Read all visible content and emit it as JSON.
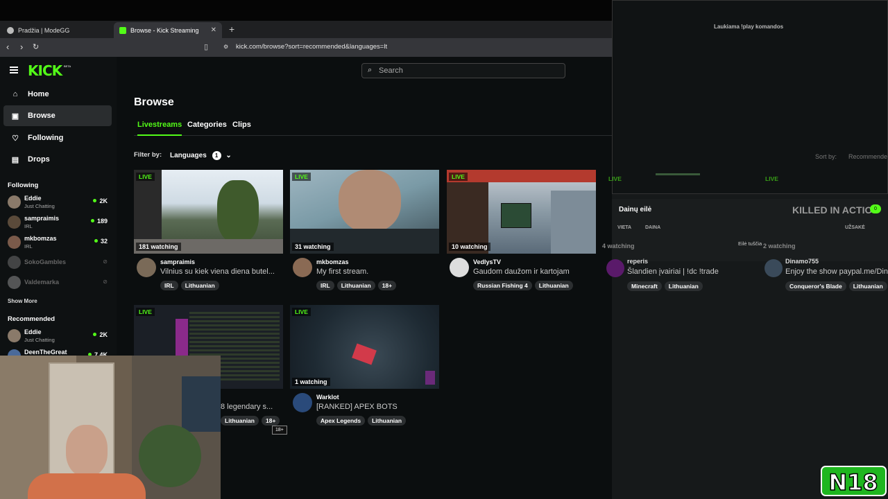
{
  "browser": {
    "tabs": [
      {
        "label": "Pradžia | ModeGG",
        "active": false
      },
      {
        "label": "Browse - Kick Streaming",
        "active": true
      }
    ],
    "new_tab": "+",
    "url": "kick.com/browse?sort=recommended&languages=lt"
  },
  "brand": {
    "logo": "KICK",
    "beta": "BETA",
    "accent": "#53fc18"
  },
  "search": {
    "placeholder": "Search"
  },
  "nav": [
    {
      "label": "Home",
      "icon": "home-icon"
    },
    {
      "label": "Browse",
      "icon": "browse-icon",
      "active": true
    },
    {
      "label": "Following",
      "icon": "heart-icon"
    },
    {
      "label": "Drops",
      "icon": "drops-icon"
    }
  ],
  "sidebar": {
    "following_title": "Following",
    "following": [
      {
        "name": "Eddie",
        "category": "Just Chatting",
        "viewers": "2K"
      },
      {
        "name": "sampraimis",
        "category": "IRL",
        "viewers": "189"
      },
      {
        "name": "mkbomzas",
        "category": "IRL",
        "viewers": "32"
      },
      {
        "name": "SokoGambles",
        "offline": true
      },
      {
        "name": "Valdemarka",
        "offline": true
      }
    ],
    "show_more": "Show More",
    "recommended_title": "Recommended",
    "recommended": [
      {
        "name": "Eddie",
        "category": "Just Chatting",
        "viewers": "2K"
      },
      {
        "name": "DeenTheGreat",
        "viewers": "7.4K"
      }
    ]
  },
  "page": {
    "title": "Browse",
    "tabs": [
      "Livestreams",
      "Categories",
      "Clips"
    ],
    "filter_label": "Filter by:",
    "languages_label": "Languages",
    "languages_count": "1"
  },
  "streams": [
    {
      "channel": "sampraimis",
      "title": "Vilnius su kiek viena diena butel...",
      "watching": "181 watching",
      "tags": [
        "IRL",
        "Lithuanian"
      ]
    },
    {
      "channel": "mkbomzas",
      "title": "My first stream.",
      "watching": "31 watching",
      "tags": [
        "IRL",
        "Lithuanian",
        "18+"
      ]
    },
    {
      "channel": "VedlysTV",
      "title": "Gaudom daužom ir kartojam",
      "watching": "10 watching",
      "tags": [
        "Russian Fishing 4",
        "Lithuanian"
      ]
    },
    {
      "channel": "",
      "title": "8 legendary s...",
      "watching": "",
      "tags": [
        "Lithuanian",
        "18+"
      ]
    },
    {
      "channel": "Warklot",
      "title": "[RANKED] APEX BOTS",
      "watching": "1 watching",
      "tags": [
        "Apex Legends",
        "Lithuanian"
      ]
    }
  ],
  "live_label": "LIVE",
  "tooltip": "18+",
  "overlay": {
    "title": "Laukiama !play komandos",
    "sort_label": "Sort by:",
    "sort_value": "Recommende",
    "queue_title": "Dainų eilė",
    "killed": "KILLED IN ACTIO",
    "queue_count": "0",
    "columns": [
      "VIETA",
      "DAINA",
      "UŽSAKĖ"
    ],
    "empty": "Eilė tuščia",
    "watch_left": "4 watching",
    "watch_right": "2 watching",
    "cards": [
      {
        "name": "reperis",
        "title": "Šlandien įvairiai | !dc !trade",
        "tags": [
          "Minecraft",
          "Lithuanian"
        ]
      },
      {
        "name": "Dinamo755",
        "title": "Enjoy the show paypal.me/Din",
        "tags": [
          "Conqueror's Blade",
          "Lithuanian"
        ]
      }
    ]
  },
  "watermark": "N18"
}
